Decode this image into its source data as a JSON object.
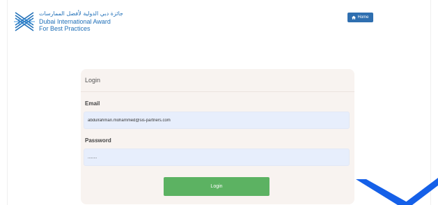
{
  "header": {
    "logo_arabic": "جائزة دبي الدولية لأفضل الممارسات",
    "logo_line1": "Dubai International Award",
    "logo_line2": "For Best Practices",
    "home_label": "Home"
  },
  "login": {
    "title": "Login",
    "email_label": "Email",
    "email_value": "abdulrahman.mohammed@sis-partners.com",
    "password_label": "Password",
    "password_value": "........",
    "submit_label": "Login"
  },
  "colors": {
    "brand_blue": "#1f6fb8",
    "home_button": "#2f6fb0",
    "login_button": "#5cb262",
    "card_background": "#f8f3f0",
    "input_background": "#e7eefc",
    "decor_blue": "#1560e8"
  },
  "icons": {
    "logo": "award-logo-icon",
    "home": "home-icon"
  }
}
